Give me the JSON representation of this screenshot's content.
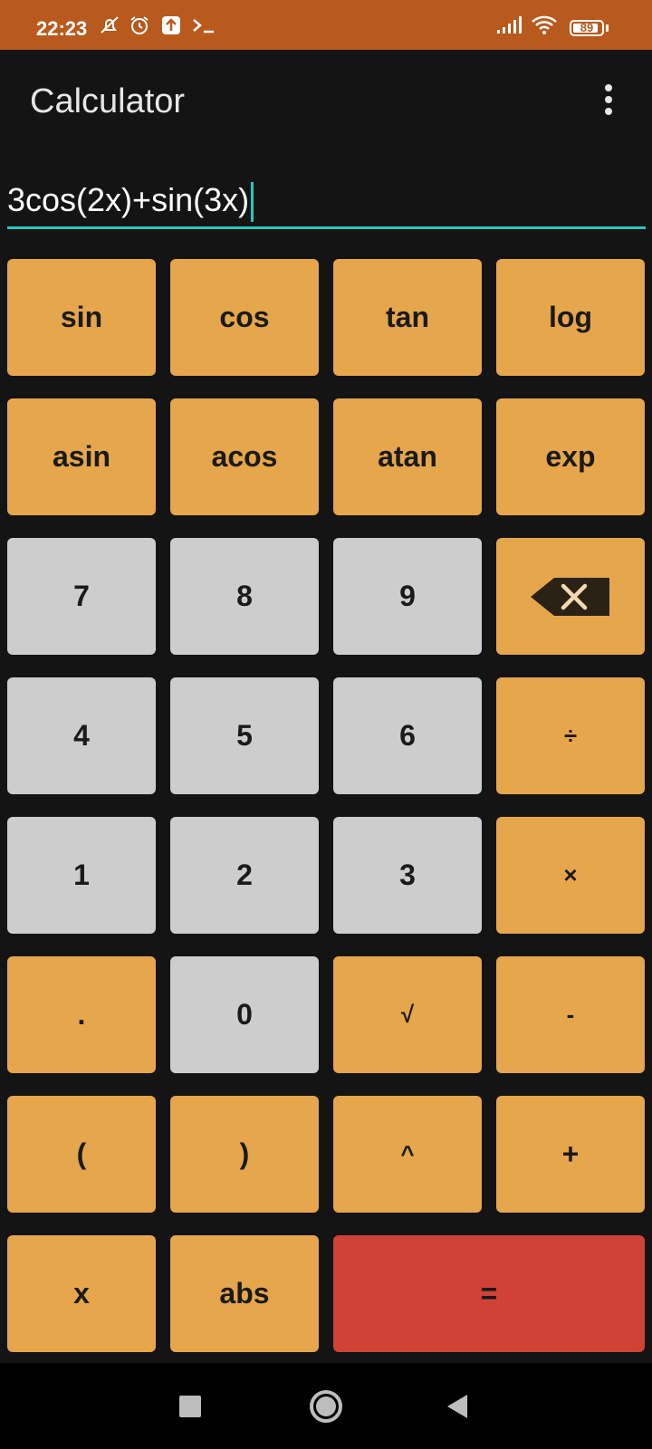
{
  "status_bar": {
    "time": "22:23",
    "battery_level": "89",
    "battery_percent": 89,
    "icons": [
      "mute-icon",
      "alarm-icon",
      "upload-icon",
      "terminal-icon",
      "signal-icon",
      "wifi-icon",
      "battery-icon"
    ],
    "background_color": "#b85a1e"
  },
  "app_bar": {
    "title": "Calculator",
    "menu_icon": "overflow-menu-icon"
  },
  "expression": {
    "value": "3cos(2x)+sin(3x)",
    "underline_color": "#22c8c0"
  },
  "keys": {
    "sin": "sin",
    "cos": "cos",
    "tan": "tan",
    "log": "log",
    "asin": "asin",
    "acos": "acos",
    "atan": "atan",
    "exp": "exp",
    "d7": "7",
    "d8": "8",
    "d9": "9",
    "backspace_icon": "backspace-icon",
    "d4": "4",
    "d5": "5",
    "d6": "6",
    "divide": "÷",
    "d1": "1",
    "d2": "2",
    "d3": "3",
    "multiply": "×",
    "dot": ".",
    "d0": "0",
    "sqrt": "√",
    "minus": "-",
    "lparen": "(",
    "rparen": ")",
    "power": "^",
    "plus": "+",
    "x": "x",
    "abs": "abs",
    "equals": "="
  },
  "colors": {
    "function_key": "#e6a64c",
    "digit_key": "#cdcdcd",
    "equals_key": "#cf4336",
    "background": "#141414"
  },
  "nav_bar": {
    "buttons": [
      "recents-square-icon",
      "home-circle-icon",
      "back-triangle-icon"
    ]
  }
}
